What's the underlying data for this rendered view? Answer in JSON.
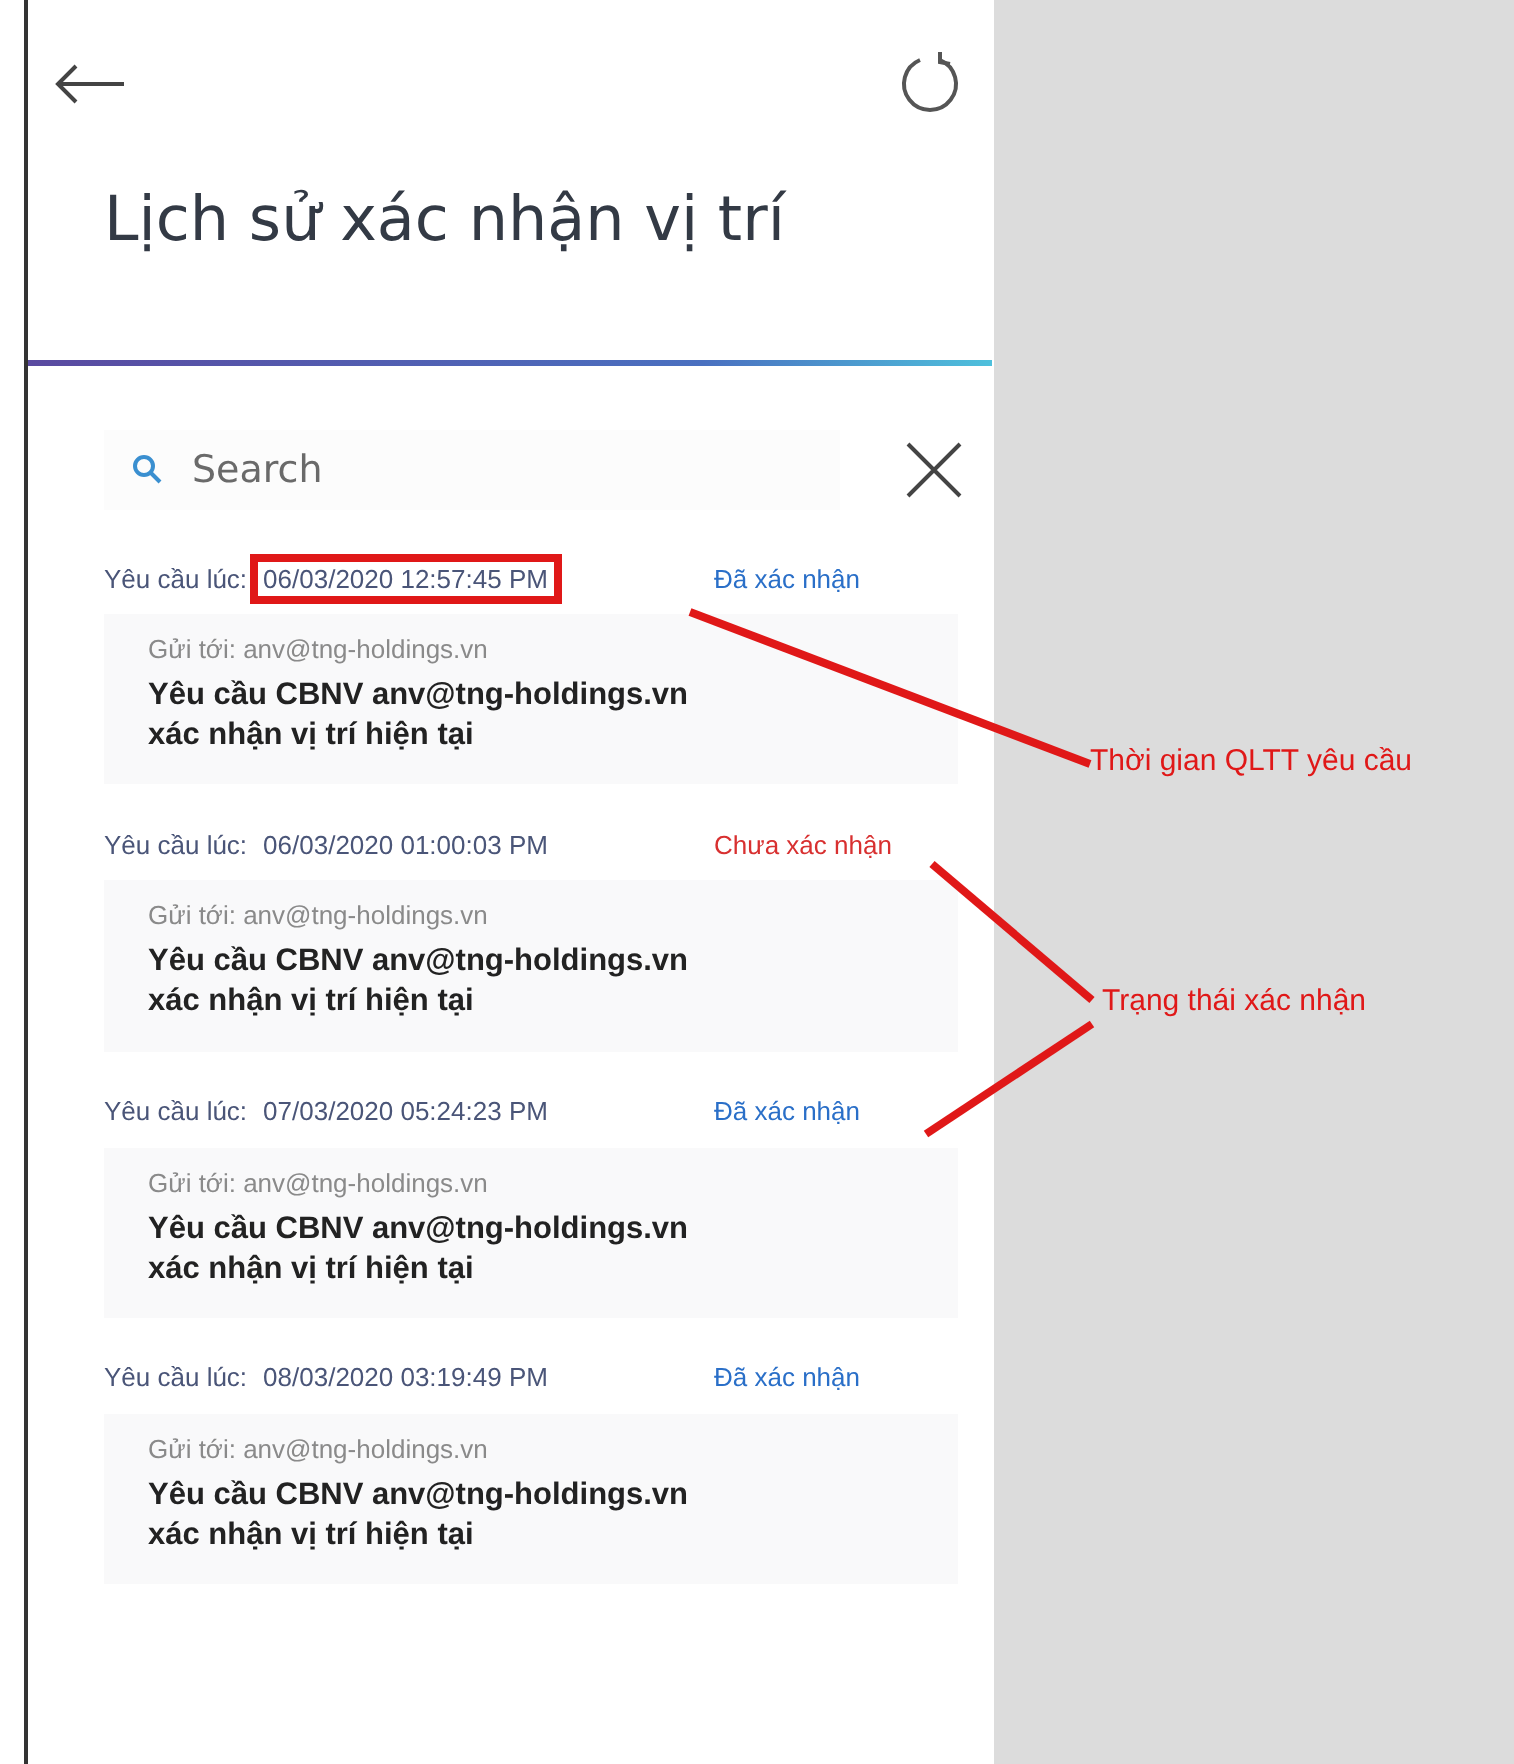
{
  "header": {
    "title": "Lịch sử xác nhận vị trí"
  },
  "search": {
    "placeholder": "Search"
  },
  "requests": [
    {
      "requested_at_label": "Yêu cầu lúc:",
      "requested_at": "06/03/2020 12:57:45 PM",
      "highlighted": true,
      "status": "Đã xác nhận",
      "confirmed": true,
      "sent_to": "Gửi tới: anv@tng-holdings.vn",
      "message": "Yêu cầu CBNV anv@tng-holdings.vn xác nhận vị trí hiện tại"
    },
    {
      "requested_at_label": "Yêu cầu lúc:",
      "requested_at": "06/03/2020 01:00:03 PM",
      "highlighted": false,
      "status": "Chưa xác nhận",
      "confirmed": false,
      "sent_to": "Gửi tới: anv@tng-holdings.vn",
      "message": "Yêu cầu CBNV anv@tng-holdings.vn xác nhận vị trí hiện tại"
    },
    {
      "requested_at_label": "Yêu cầu lúc:",
      "requested_at": "07/03/2020 05:24:23 PM",
      "highlighted": false,
      "status": "Đã xác nhận",
      "confirmed": true,
      "sent_to": "Gửi tới: anv@tng-holdings.vn",
      "message": "Yêu cầu CBNV anv@tng-holdings.vn xác nhận vị trí hiện tại"
    },
    {
      "requested_at_label": "Yêu cầu lúc:",
      "requested_at": "08/03/2020 03:19:49 PM",
      "highlighted": false,
      "status": "Đã xác nhận",
      "confirmed": true,
      "sent_to": "Gửi tới: anv@tng-holdings.vn",
      "message": "Yêu cầu CBNV anv@tng-holdings.vn xác nhận vị trí hiện tại"
    }
  ],
  "annotations": [
    {
      "text": "Thời gian QLTT yêu cầu"
    },
    {
      "text": "Trạng thái xác nhận"
    }
  ]
}
